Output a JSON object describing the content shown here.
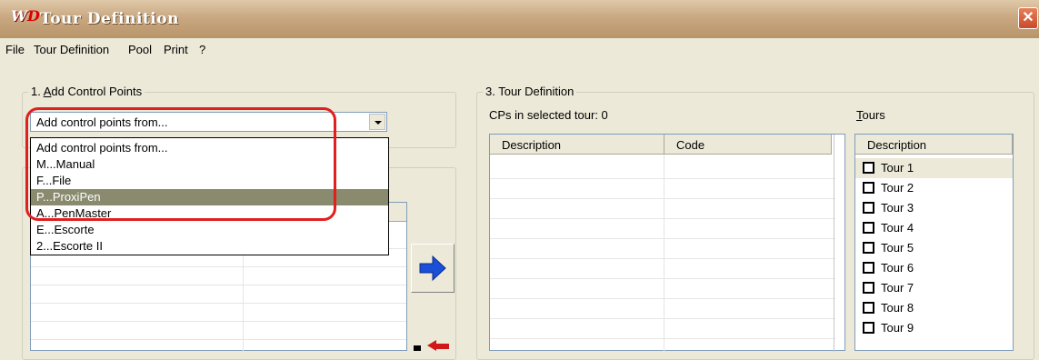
{
  "window": {
    "title": "Tour Definition",
    "icon_text_w": "W",
    "icon_text_d": "D",
    "close_label": "✕"
  },
  "menu": [
    "File",
    "Tour Definition",
    "Pool",
    "Print",
    "?"
  ],
  "add_control_points": {
    "group_title": "1. Add Control Points",
    "title_underline": "A",
    "combo_value": "Add control points from...",
    "options": [
      "Add control points from...",
      "M...Manual",
      "F...File",
      "P...ProxiPen",
      "A...PenMaster",
      "E...Escorte",
      "2...Escorte II"
    ],
    "selected_option": "P...ProxiPen"
  },
  "tour_definition": {
    "group_title": "3. Tour Definition",
    "cps_label": "CPs in selected tour: 0",
    "tours_label": "Tours",
    "columns": [
      "Description",
      "Code"
    ],
    "tours_column": "Description",
    "tours": [
      "Tour 1",
      "Tour 2",
      "Tour 3",
      "Tour 4",
      "Tour 5",
      "Tour 6",
      "Tour 7",
      "Tour 8",
      "Tour 9"
    ],
    "selected_tour": "Tour 1"
  },
  "colors": {
    "selection_bg": "#8a8a6e",
    "highlight": "#e02020",
    "arrow_blue": "#1a4fd8",
    "arrow_red": "#d01818"
  }
}
